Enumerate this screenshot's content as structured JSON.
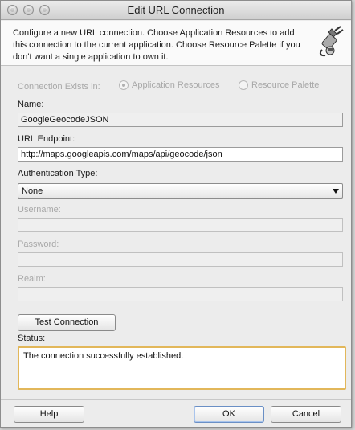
{
  "window": {
    "title": "Edit URL Connection"
  },
  "header": {
    "description": "Configure a new URL connection.  Choose Application Resources to add this connection to the current application. Choose Resource Palette if you don't want a single application to own it.",
    "icon": "plug-connection-icon"
  },
  "connection_exists": {
    "label": "Connection Exists in:",
    "options": [
      {
        "label": "Application Resources",
        "selected": true
      },
      {
        "label": "Resource Palette",
        "selected": false
      }
    ]
  },
  "fields": {
    "name": {
      "label": "Name:",
      "value": "GoogleGeocodeJSON"
    },
    "url": {
      "label": "URL Endpoint:",
      "value": "http://maps.googleapis.com/maps/api/geocode/json"
    },
    "auth_type": {
      "label": "Authentication Type:",
      "value": "None"
    },
    "username": {
      "label": "Username:",
      "value": ""
    },
    "password": {
      "label": "Password:",
      "value": ""
    },
    "realm": {
      "label": "Realm:",
      "value": ""
    }
  },
  "test_button": "Test Connection",
  "status": {
    "label": "Status:",
    "message": "The connection successfully established."
  },
  "buttons": {
    "help": "Help",
    "ok": "OK",
    "cancel": "Cancel"
  },
  "colors": {
    "status_border": "#e2b75a",
    "ok_focus": "#6a8fc5"
  }
}
